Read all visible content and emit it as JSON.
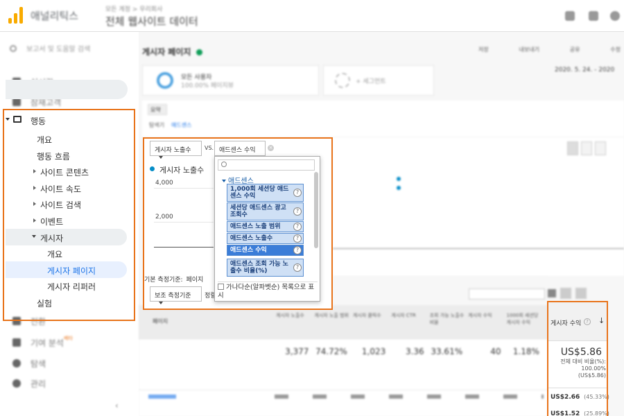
{
  "topbar": {
    "app_name": "애널리틱스",
    "account_sub": "모든 계정 > 우리회사",
    "account_main": "전체 웹사이트 데이터"
  },
  "sidebar": {
    "search_placeholder": "보고서 및 도움말 검색",
    "realtime": "실시간",
    "audience": "잠재고객",
    "behavior": "행동",
    "overview": "개요",
    "behavior_flow": "행동 흐름",
    "site_content": "사이트 콘텐츠",
    "site_speed": "사이트 속도",
    "site_search": "사이트 검색",
    "events": "이벤트",
    "publisher": "게시자",
    "pub_overview": "개요",
    "pub_pages": "게시자 페이지",
    "pub_referrers": "게시자 리퍼러",
    "experiments": "실험",
    "conversions": "전환",
    "attribution": "기여 분석",
    "beta": "베타",
    "discover": "탐색",
    "admin": "관리"
  },
  "main": {
    "page_title": "게시자 페이지",
    "date_range": "2020. 5. 24. - 2020",
    "segment_name": "모든 사용자",
    "segment_sub": "100.00% 페이지뷰",
    "add_segment": "+ 세그먼트",
    "toolbar": [
      "저장",
      "내보내기",
      "공유",
      "수정"
    ],
    "tab_summary": "요약",
    "tab_explorer_label": "탐색기",
    "tab_explorer_link": "애드센스"
  },
  "chart": {
    "metric_select": "게시자 노출수",
    "vs_label": "VS.",
    "compare_select": "애드센스 수익",
    "legend_label": "게시자 노출수",
    "y_ticks": [
      "4,000",
      "2,000"
    ],
    "primary_dim_label": "기본 측정기준:",
    "primary_dim_value": "페이지",
    "secondary_dim": "보조 측정기준",
    "sort_label": "정렬"
  },
  "dropdown": {
    "category": "애드센스",
    "items": [
      {
        "label": "1,000회 세션당 애드센스 수익",
        "selected": false
      },
      {
        "label": "세션당 애드센스 광고 조회수",
        "selected": false
      },
      {
        "label": "애드센스 노출 범위",
        "selected": false
      },
      {
        "label": "애드센스 노출수",
        "selected": false
      },
      {
        "label": "애드센스 수익",
        "selected": true
      },
      {
        "label": "애드센스 조회 가능 노출수 비율(%)",
        "selected": false
      }
    ],
    "help_glyph": "?",
    "footer_text": "가나다순(알파벳순) 목록으로 표시"
  },
  "table": {
    "head_first": "페이지",
    "columns": [
      "게시자 노출수",
      "게시자 노출 범위",
      "게시자 클릭수",
      "게시자 CTR",
      "조회 가능 노출수 비율",
      "게시자 수익",
      "1000회 세션당 게시자 수익"
    ],
    "totals": [
      "3,377",
      "74.72%",
      "1,023",
      "3.36",
      "33.61%",
      "40",
      "1.18%"
    ]
  },
  "revenue": {
    "header": "게시자 수익",
    "total": "US$5.86",
    "total_sub": "전체 대비 비율(%): 100.00% (US$5.86)",
    "rows": [
      {
        "value": "US$2.66",
        "pct": "(45.33%)"
      },
      {
        "value": "US$1.52",
        "pct": "(25.89%)"
      }
    ]
  },
  "colors": {
    "highlight": "#e8731a",
    "accent_blue": "#1a73e8",
    "series_blue": "#058dc7"
  }
}
